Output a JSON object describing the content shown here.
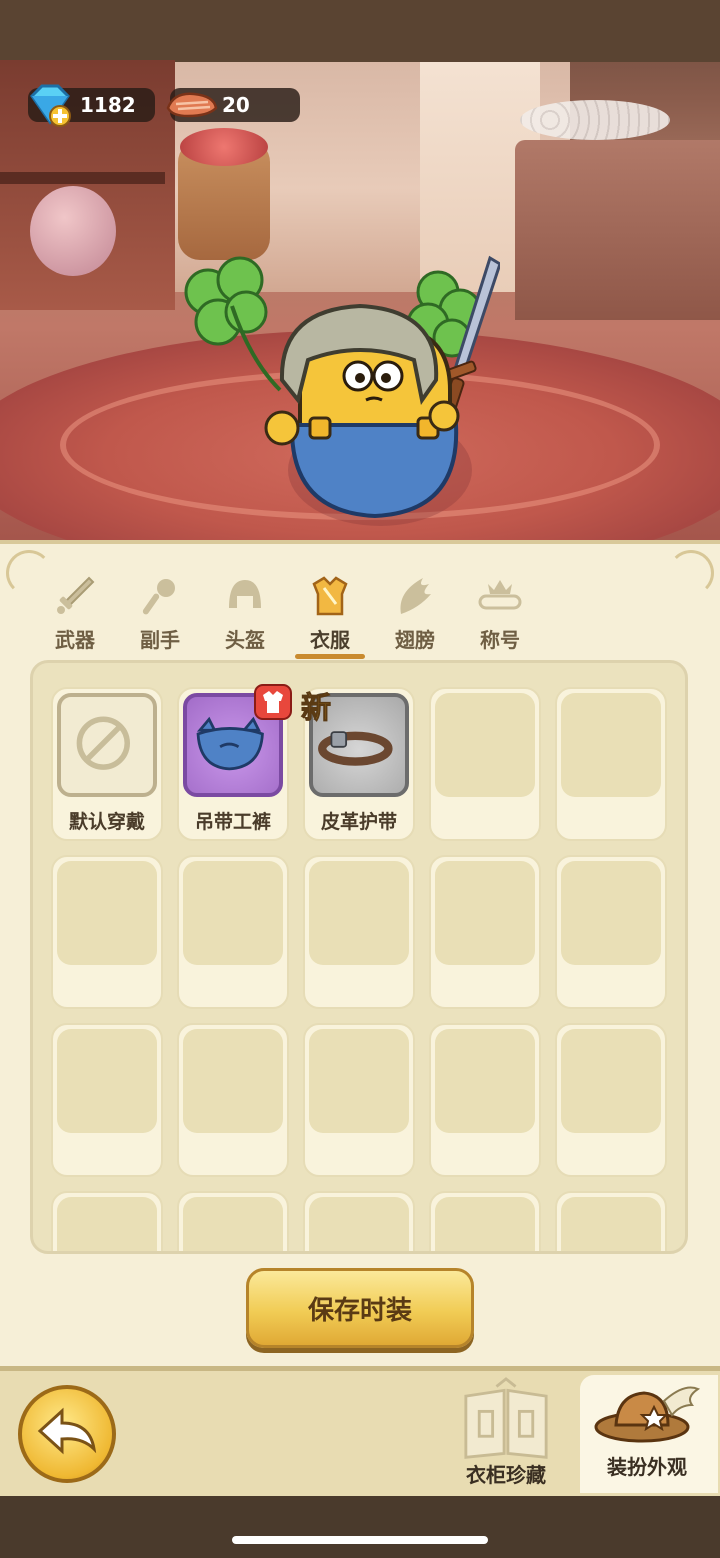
{
  "resources": {
    "gems": "1182",
    "meat": "20"
  },
  "tabs": [
    {
      "label": "武器",
      "icon": "sword-icon"
    },
    {
      "label": "副手",
      "icon": "offhand-icon"
    },
    {
      "label": "头盔",
      "icon": "helmet-icon"
    },
    {
      "label": "衣服",
      "icon": "armor-icon",
      "active": true
    },
    {
      "label": "翅膀",
      "icon": "wings-icon"
    },
    {
      "label": "称号",
      "icon": "title-crown-icon"
    }
  ],
  "items": [
    {
      "label": "默认穿戴",
      "kind": "default"
    },
    {
      "label": "吊带工裤",
      "kind": "overalls",
      "equipped": true
    },
    {
      "label": "皮革护带",
      "kind": "leather-belt",
      "badge": "新"
    }
  ],
  "save_button": "保存时装",
  "bottom": {
    "wardrobe": "衣柜珍藏",
    "dressup": "装扮外观"
  },
  "colors": {
    "panel_bg": "#f6efd7",
    "button_gold": "#f1cc55",
    "tab_underline": "#c98a2e",
    "rare_purple": "#a26cc8"
  }
}
